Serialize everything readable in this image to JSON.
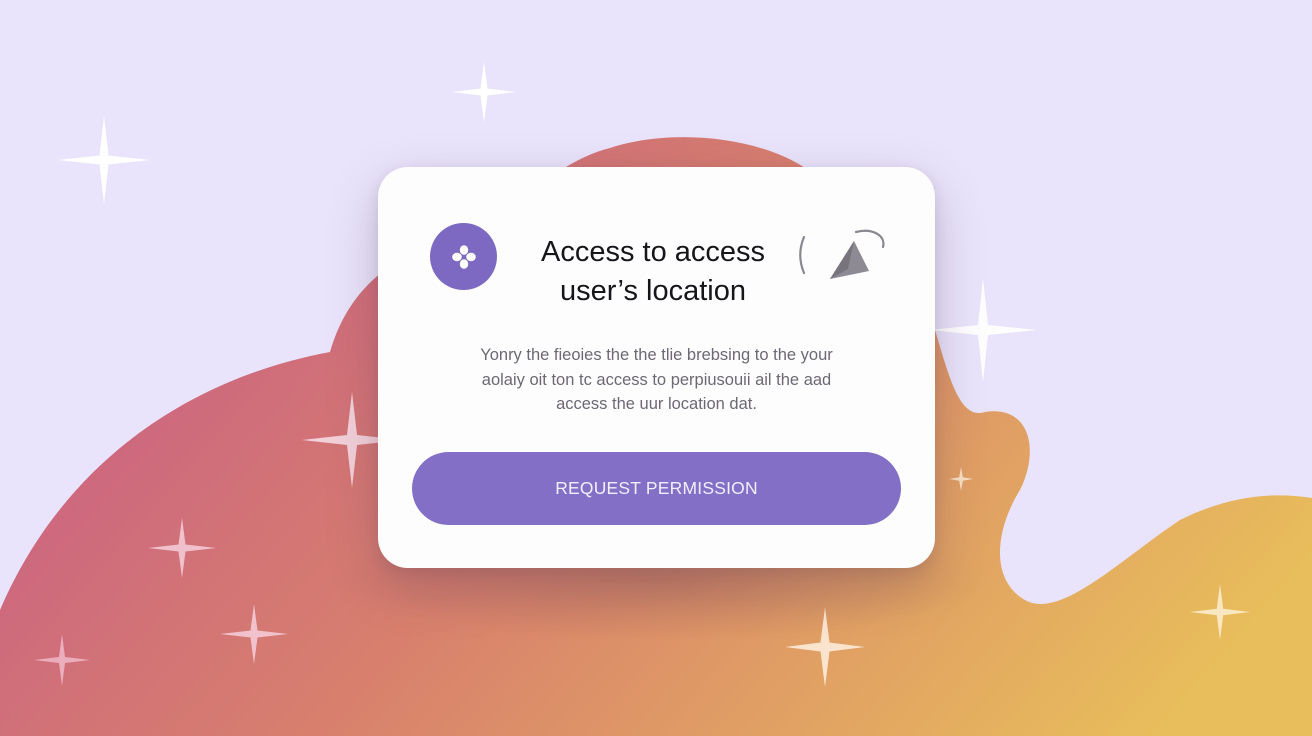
{
  "dialog": {
    "title_line1": "Access to access",
    "title_line2": "user’s location",
    "body_line1": "Yonry the fieoies the the tlie brebsing to the your",
    "body_line2": "aolaiy oit ton tc access to perpiusouii ail the aad",
    "body_line3": "access the uur location dat.",
    "button_label": "REQUEST PERMISSION",
    "app_icon": "sparkle-flower-icon",
    "location_icon": "location-arrow-icon"
  },
  "colors": {
    "background": "#e9e4fb",
    "accent": "#7e69c2",
    "button": "#8370c6",
    "button_text": "#f2eefb",
    "blob_start": "#c85d86",
    "blob_mid": "#d8806d",
    "blob_end": "#e8bd5b"
  }
}
